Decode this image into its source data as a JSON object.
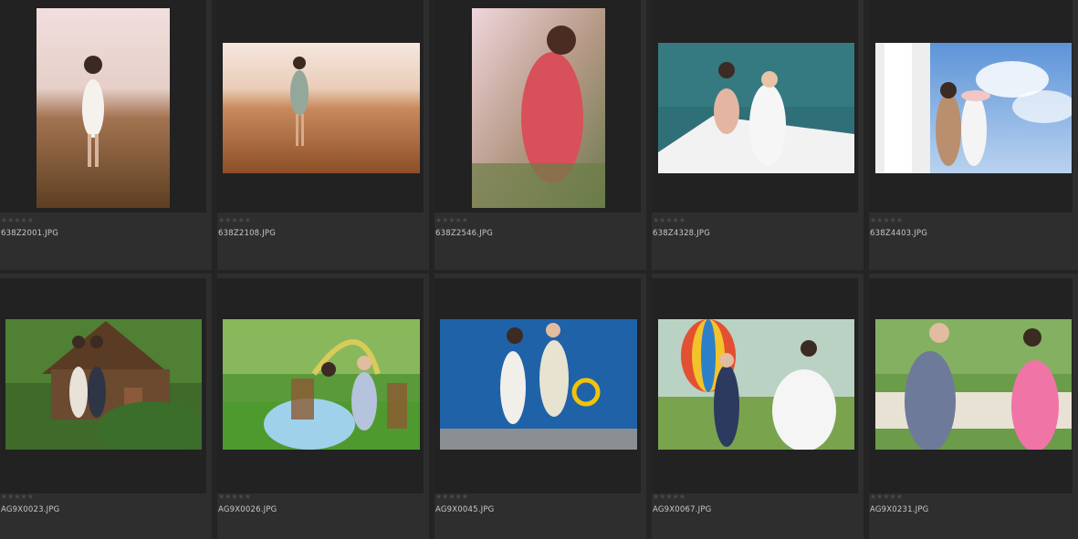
{
  "rows": [
    {
      "items": [
        {
          "filename": "638Z2001.JPG",
          "rating": "★★★★★",
          "subject": "woman in white dress in dry field"
        },
        {
          "filename": "638Z2108.JPG",
          "rating": "★★★★★",
          "subject": "woman in field at sunrise"
        },
        {
          "filename": "638Z2546.JPG",
          "rating": "★★★★★",
          "subject": "woman in red floral dress"
        },
        {
          "filename": "638Z4328.JPG",
          "rating": "★★★★★",
          "subject": "couple on boat deck"
        },
        {
          "filename": "638Z4403.JPG",
          "rating": "★★★★★",
          "subject": "couple by white column with sky"
        }
      ]
    },
    {
      "items": [
        {
          "filename": "AG9X0023.JPG",
          "rating": "★★★★★",
          "subject": "couple at wooden cabin"
        },
        {
          "filename": "AG9X0026.JPG",
          "rating": "★★★★★",
          "subject": "couple seated on lawn"
        },
        {
          "filename": "AG9X0045.JPG",
          "rating": "★★★★★",
          "subject": "couple in front of blue wall"
        },
        {
          "filename": "AG9X0067.JPG",
          "rating": "★★★★★",
          "subject": "couple with hot air balloon"
        },
        {
          "filename": "AG9X0231.JPG",
          "rating": "★★★★★",
          "subject": "couple in garden with pink dress"
        }
      ]
    }
  ]
}
